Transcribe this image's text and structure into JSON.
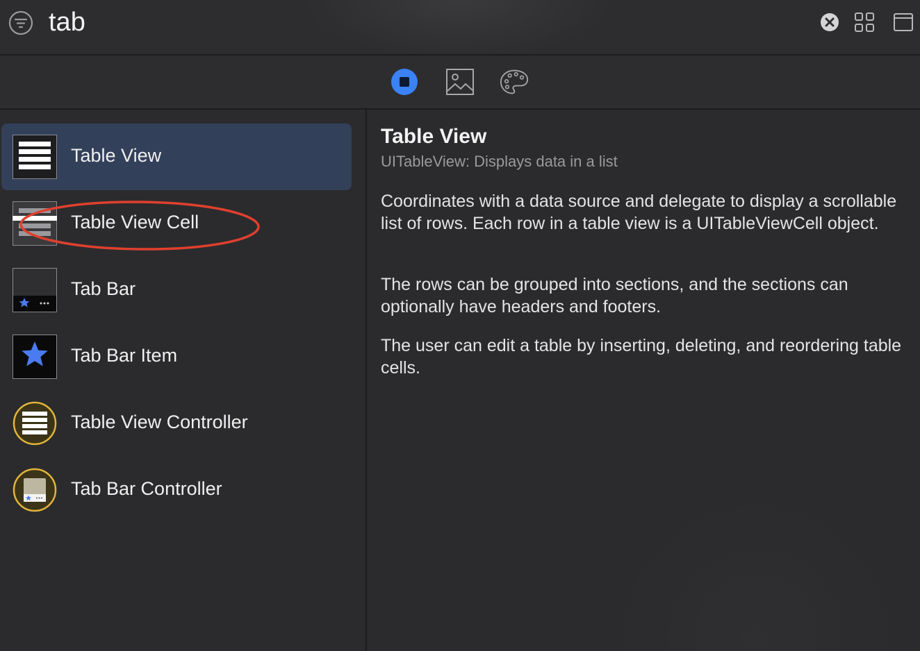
{
  "search": {
    "query": "tab"
  },
  "toolbar": {
    "icons": [
      "filter-icon",
      "clear-search-icon",
      "grid-view-icon",
      "panel-toggle-icon"
    ]
  },
  "categories": {
    "items": [
      {
        "icon": "objects-icon",
        "selected": true
      },
      {
        "icon": "media-icon",
        "selected": false
      },
      {
        "icon": "colors-icon",
        "selected": false
      }
    ],
    "accent": "#3b82f6"
  },
  "library": {
    "items": [
      {
        "label": "Table View",
        "icon": "table-view-icon",
        "selected": true
      },
      {
        "label": "Table View Cell",
        "icon": "table-view-cell-icon",
        "selected": false
      },
      {
        "label": "Tab Bar",
        "icon": "tab-bar-icon",
        "selected": false
      },
      {
        "label": "Tab Bar Item",
        "icon": "tab-bar-item-icon",
        "selected": false
      },
      {
        "label": "Table View Controller",
        "icon": "table-view-controller-icon",
        "selected": false
      },
      {
        "label": "Tab Bar Controller",
        "icon": "tab-bar-controller-icon",
        "selected": false
      }
    ]
  },
  "detail": {
    "title": "Table View",
    "subtitle": "UITableView: Displays data in a list",
    "paragraphs": [
      "Coordinates with a data source and delegate to display a scrollable list of rows. Each row in a table view is a UITableViewCell object.",
      "The rows can be grouped into sections, and the sections can optionally have headers and footers.",
      "The user can edit a table by inserting, deleting, and reordering table cells."
    ]
  },
  "colors": {
    "selection": "#33405a",
    "annotation": "#e0402e",
    "controller_ring": "#e2b53a"
  }
}
